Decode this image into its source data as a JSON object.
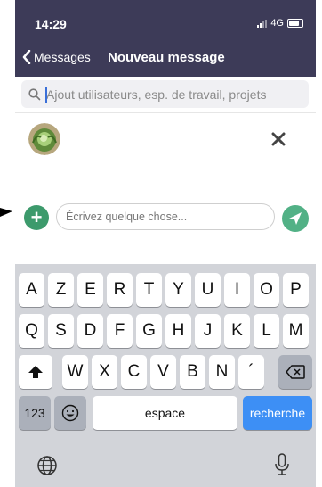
{
  "status": {
    "time": "14:29",
    "network": "4G"
  },
  "nav": {
    "back_label": "Messages",
    "title": "Nouveau message"
  },
  "search": {
    "placeholder": "Ajout utilisateurs, esp. de travail, projets",
    "value": ""
  },
  "recipient": {
    "avatar": "cabbage-avatar",
    "remove_icon": "close-icon"
  },
  "composer": {
    "placeholder": "Écrivez quelque chose...",
    "add_icon": "plus-icon",
    "send_icon": "send-icon"
  },
  "keyboard": {
    "row1": [
      "A",
      "Z",
      "E",
      "R",
      "T",
      "Y",
      "U",
      "I",
      "O",
      "P"
    ],
    "row2": [
      "Q",
      "S",
      "D",
      "F",
      "G",
      "H",
      "J",
      "K",
      "L",
      "M"
    ],
    "row3": [
      "W",
      "X",
      "C",
      "V",
      "B",
      "N",
      "´"
    ],
    "numbers_label": "123",
    "space_label": "espace",
    "action_label": "recherche"
  },
  "colors": {
    "header": "#3d3b58",
    "accent_green": "#3d9a6c",
    "send_green": "#52b186",
    "key_blue": "#3d8ff5"
  }
}
